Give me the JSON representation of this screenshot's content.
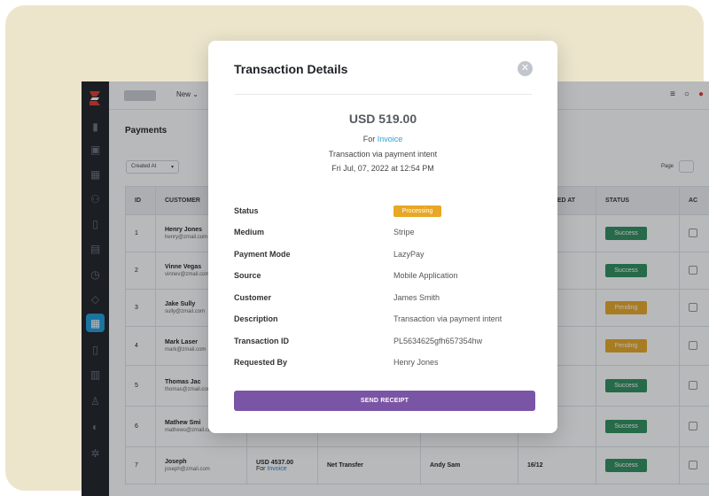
{
  "app": {
    "topbar": {
      "new_label": "New ⌄",
      "menu_icon": "hamburger-icon",
      "chat_icon": "chat-icon",
      "bell_icon": "notification-icon"
    },
    "page_title": "Payments",
    "filter": {
      "label": "Created At"
    },
    "pagination": {
      "label": "Page",
      "value": ""
    },
    "table": {
      "headers": [
        "ID",
        "CUSTOMER",
        "",
        "",
        "",
        "REQUESTED AT",
        "STATUS",
        "AC"
      ],
      "rows": [
        {
          "id": "1",
          "name": "Henry Jones",
          "email": "henry@zmail.com",
          "amount": "",
          "for": "",
          "method": "",
          "agent": "",
          "date": "",
          "status": "Success",
          "status_color": "#2e8f5c"
        },
        {
          "id": "2",
          "name": "Vinne Vegas",
          "email": "vinnev@zmail.com",
          "amount": "",
          "for": "",
          "method": "",
          "agent": "",
          "date": "",
          "status": "Success",
          "status_color": "#2e8f5c"
        },
        {
          "id": "3",
          "name": "Jake Sully",
          "email": "sully@zmail.com",
          "amount": "",
          "for": "",
          "method": "",
          "agent": "",
          "date": "",
          "status": "Pending",
          "status_color": "#e8a825"
        },
        {
          "id": "4",
          "name": "Mark Laser",
          "email": "mark@zmail.com",
          "amount": "",
          "for": "",
          "method": "",
          "agent": "",
          "date": "",
          "status": "Pending",
          "status_color": "#e8a825"
        },
        {
          "id": "5",
          "name": "Thomas Jac",
          "email": "thomas@zmail.com",
          "amount": "",
          "for": "",
          "method": "",
          "agent": "",
          "date": "",
          "status": "Success",
          "status_color": "#2e8f5c"
        },
        {
          "id": "6",
          "name": "Mathew Smi",
          "email": "mathews@zmail.com",
          "amount": "",
          "for": "For",
          "invoice": "Invoice",
          "method": "",
          "agent": "",
          "date": "",
          "status": "Success",
          "status_color": "#2e8f5c"
        },
        {
          "id": "7",
          "name": "Joseph",
          "email": "joseph@zmail.com",
          "amount": "USD 4537.00",
          "for": "For",
          "invoice": "Invoice",
          "method": "Net Transfer",
          "agent": "Andy Sam",
          "date": "16/12",
          "status": "Success",
          "status_color": "#2e8f5c"
        }
      ]
    }
  },
  "modal": {
    "title": "Transaction Details",
    "close_icon": "close-icon",
    "amount": "USD 519.00",
    "for_prefix": "For",
    "for_link": "Invoice",
    "via": "Transaction via payment intent",
    "date": "Fri Jul, 07, 2022 at 12:54 PM",
    "details": [
      {
        "label": "Status",
        "value": "Processing",
        "badge": true,
        "badge_color": "#e8a825"
      },
      {
        "label": "Medium",
        "value": "Stripe"
      },
      {
        "label": "Payment Mode",
        "value": "LazyPay"
      },
      {
        "label": "Source",
        "value": "Mobile Application"
      },
      {
        "label": "Customer",
        "value": "James Smith"
      },
      {
        "label": "Description",
        "value": "Transaction via payment intent"
      },
      {
        "label": "Transaction ID",
        "value": "PL5634625gfh657354hw"
      },
      {
        "label": "Requested By",
        "value": "Henry Jones"
      }
    ],
    "send_button": "SEND RECEIPT",
    "accent_color": "#7b55a5"
  }
}
